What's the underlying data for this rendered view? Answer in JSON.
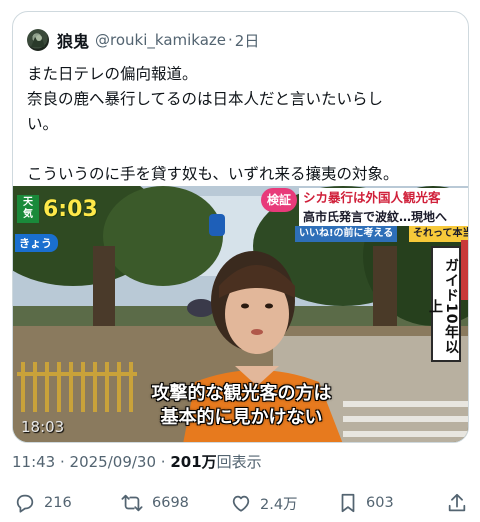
{
  "quoted_post": {
    "author_name": "狼鬼",
    "handle": "@rouki_kamikaze",
    "separator": "·",
    "time": "2日",
    "text": "また日テレの偏向報道。\n奈良の鹿へ暴行してるのは日本人だと言いたいらし\nい。\n\nこういうのに手を貸す奴も、いずれ来る攘夷の対象。"
  },
  "media": {
    "clock_tag": "天気",
    "clock": "6:03",
    "today_label": "きょう",
    "topic_badge": "検証",
    "headline_1": "シカ暴行は外国人観光客",
    "headline_2": "高市氏発言で波紋…現地へ",
    "sub_left": "いいね!の前に考える",
    "sub_right": "それって本当",
    "side_panel": "ガイド10年以上",
    "caption": "攻撃的な観光客の方は\n基本的に見かけない",
    "stamp": "18:03"
  },
  "meta": {
    "time": "11:43",
    "separator": " · ",
    "date": "2025/09/30",
    "separator2": " · ",
    "views_count": "201万",
    "views_label": "回表示"
  },
  "actions": {
    "replies": "216",
    "reposts": "6698",
    "likes": "2.4万",
    "bookmarks": "603"
  },
  "icons": {
    "reply": "reply-icon",
    "repost": "repost-icon",
    "like": "like-icon",
    "bookmark": "bookmark-icon",
    "share": "share-icon"
  },
  "colors": {
    "text_primary": "#0f1419",
    "text_secondary": "#536471",
    "border": "#cfd9de",
    "tv_pink": "#e83a7a",
    "tv_yellow": "#ffe94a"
  }
}
